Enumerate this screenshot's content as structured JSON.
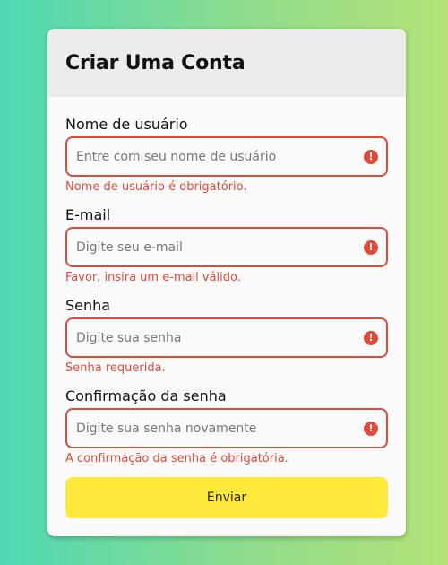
{
  "form": {
    "title": "Criar Uma Conta",
    "fields": [
      {
        "label": "Nome de usuário",
        "placeholder": "Entre com seu nome de usuário",
        "value": "",
        "error": "Nome de usuário é obrigatório.",
        "icon": "error-icon"
      },
      {
        "label": "E-mail",
        "placeholder": "Digite seu e-mail",
        "value": "",
        "error": "Favor, insira um e-mail válido.",
        "icon": "error-icon"
      },
      {
        "label": "Senha",
        "placeholder": "Digite sua senha",
        "value": "",
        "error": "Senha requerida.",
        "icon": "error-icon"
      },
      {
        "label": "Confirmação da senha",
        "placeholder": "Digite sua senha novamente",
        "value": "",
        "error": "A confirmação da senha é obrigatória.",
        "icon": "error-icon"
      }
    ],
    "submit_label": "Enviar"
  },
  "colors": {
    "error": "#e04a3b",
    "submit_bg": "#ffe93b",
    "header_bg": "#ececec",
    "card_bg": "#fafafa",
    "background_gradient": [
      "#4fd8b4",
      "#b4e278"
    ]
  }
}
